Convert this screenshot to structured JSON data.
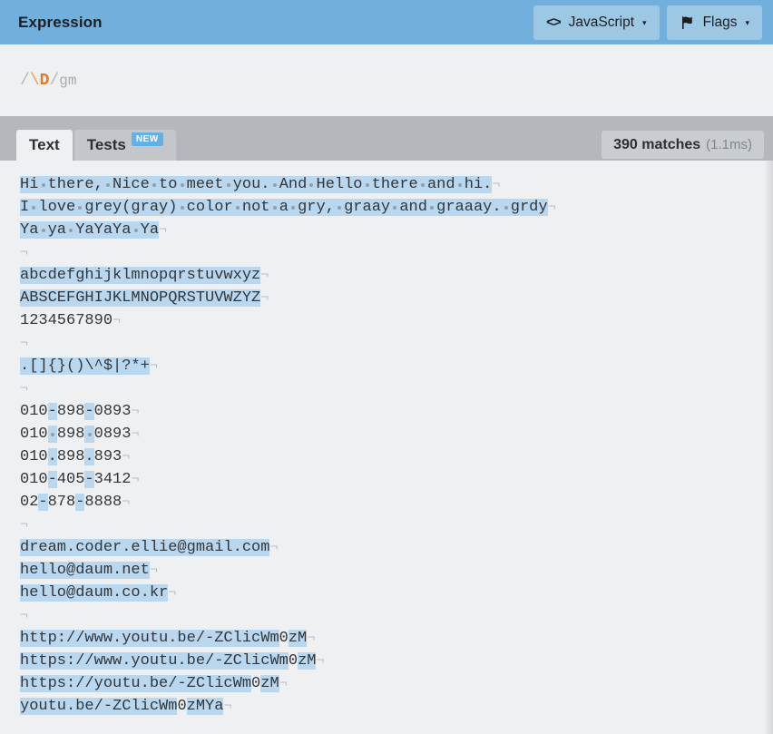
{
  "header": {
    "title": "Expression",
    "buttons": [
      {
        "name": "javascript",
        "label": "JavaScript",
        "icon": "code-icon",
        "caret": "▾"
      },
      {
        "name": "flags",
        "label": "Flags",
        "icon": "flag-icon",
        "caret": "▾"
      }
    ]
  },
  "expression": {
    "open_delimiter": "/",
    "escape": "\\",
    "token": "D",
    "close_delimiter": "/",
    "flags": "gm",
    "full": "/\\D/gm"
  },
  "tabs": [
    {
      "name": "text",
      "label": "Text",
      "active": true,
      "badge": null
    },
    {
      "name": "tests",
      "label": "Tests",
      "active": false,
      "badge": "NEW"
    }
  ],
  "status": {
    "matches": "390 matches",
    "time": "(1.1ms)"
  },
  "eol_marker": "¬",
  "text_lines": [
    "Hi there, Nice to meet you. And Hello there and hi.",
    "I love grey(gray) color not a gry, graay and graaay. grdy",
    "Ya ya YaYaYa Ya",
    "",
    "abcdefghijklmnopqrstuvwxyz",
    "ABSCEFGHIJKLMNOPQRSTUVWZYZ",
    "1234567890",
    "",
    ".[]{}()\\^$|?*+",
    "",
    "010-898-0893",
    "010 898 0893",
    "010.898.893",
    "010-405-3412",
    "02-878-8888",
    "",
    "dream.coder.ellie@gmail.com",
    "hello@daum.net",
    "hello@daum.co.kr",
    "",
    "http://www.youtu.be/-ZClicWm0zM",
    "https://www.youtu.be/-ZClicWm0zM",
    "https://youtu.be/-ZClicWm0zM",
    "youtu.be/-ZClicWm0zMYa"
  ],
  "colors": {
    "header_blue": "#71b0dd",
    "header_button_blue": "#9cc8e4",
    "panel_bg": "#eff0f1",
    "chrome_gray": "#b4b8bd",
    "highlight_blue": "#b9d8ef",
    "badge_blue": "#63b0e4",
    "token_orange": "#e07b1f"
  }
}
